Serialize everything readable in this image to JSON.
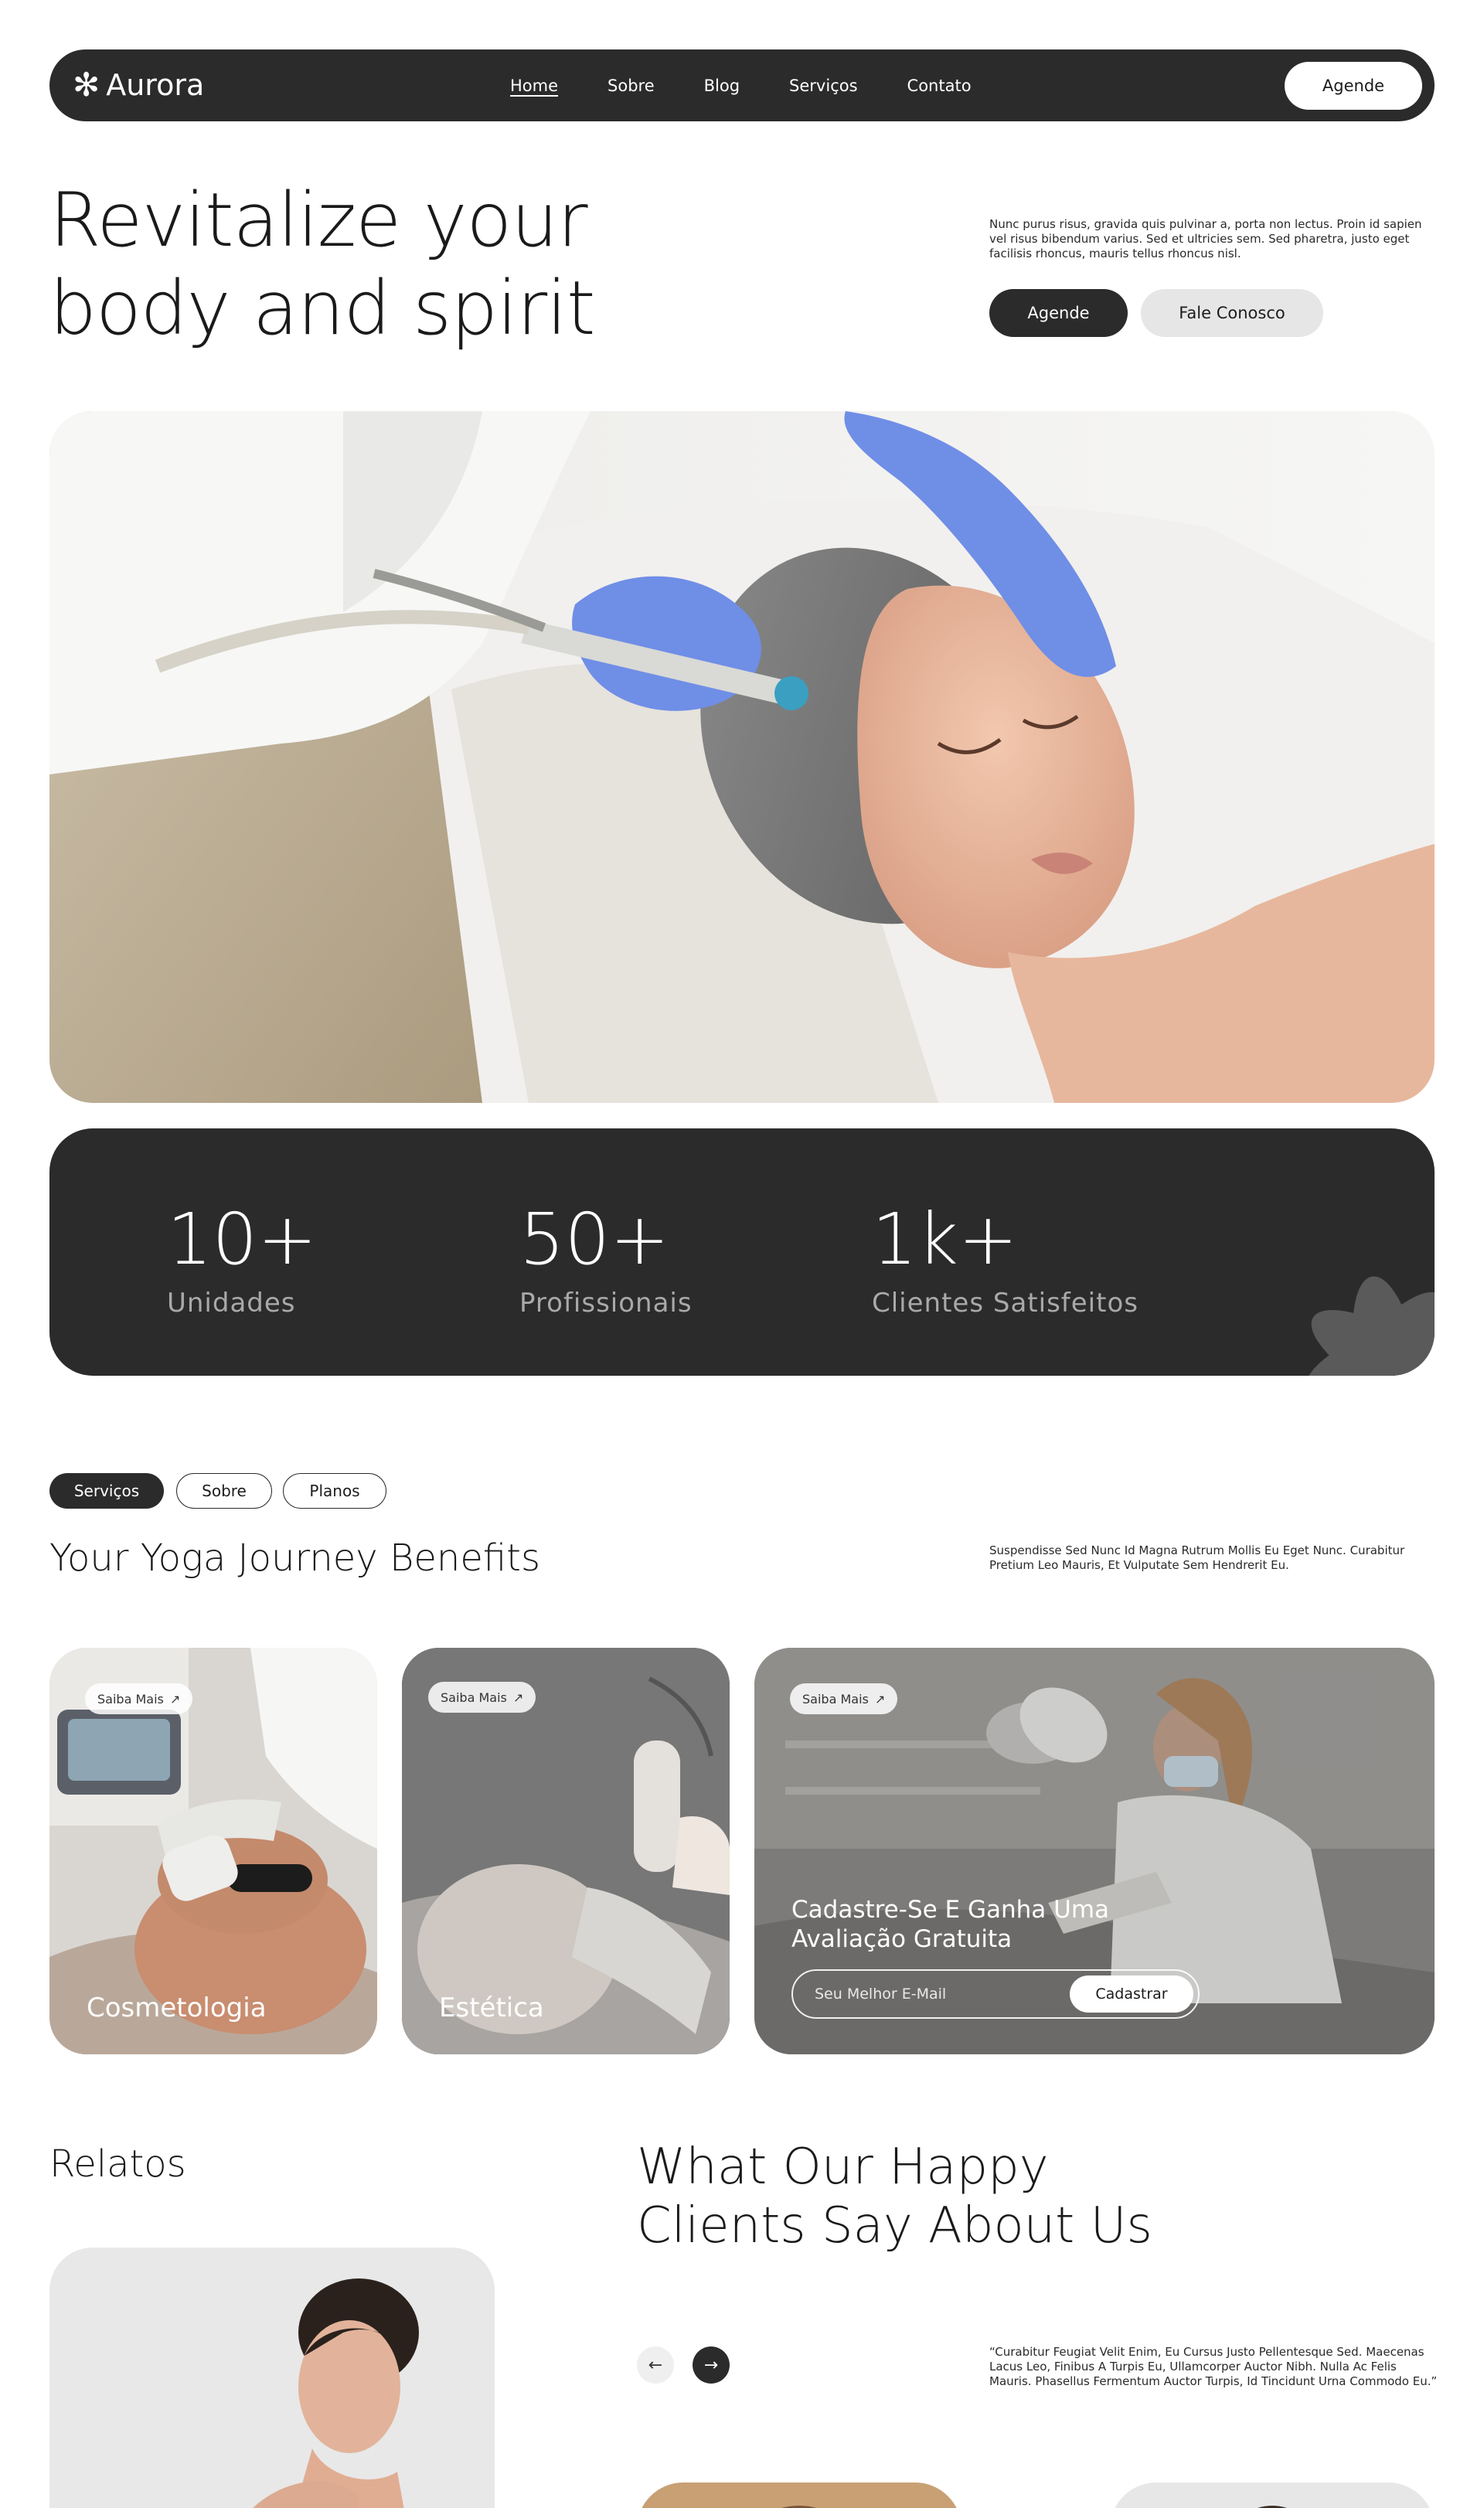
{
  "nav": {
    "logo_text": "Aurora",
    "logo_mark": "✻",
    "links": [
      "Home",
      "Sobre",
      "Blog",
      "Serviços",
      "Contato"
    ],
    "active": "Home",
    "cta_label": "Agende"
  },
  "hero": {
    "title_line1": "Revitalize your",
    "title_line2": "body and spirit",
    "text": "Nunc purus risus, gravida quis pulvinar a, porta non lectus. Proin id sapien vel risus bibendum varius. Sed et ultricies sem. Sed pharetra, justo eget facilisis rhoncus, mauris tellus rhoncus nisl.",
    "primary_label": "Agende",
    "secondary_label": "Fale Conosco"
  },
  "stats": [
    {
      "value": "10+",
      "label": "Unidades"
    },
    {
      "value": "50+",
      "label": "Profissionais"
    },
    {
      "value": "1k+",
      "label": "Clientes Satisfeitos"
    }
  ],
  "services": {
    "tabs": [
      "Serviços",
      "Sobre",
      "Planos"
    ],
    "active_tab": "Serviços",
    "title": "Your Yoga Journey Benefits",
    "text": "Suspendisse Sed Nunc Id Magna Rutrum Mollis Eu Eget Nunc. Curabitur Pretium Leo Mauris, Et Vulputate Sem Hendrerit Eu.",
    "chip_label": "Saiba Mais",
    "cards": [
      {
        "label": "Cosmetologia"
      },
      {
        "label": "Estética"
      }
    ],
    "promo": {
      "title": "Cadastre-Se E Ganha Uma Avaliação Gratuita",
      "input_placeholder": "Seu Melhor E-Mail",
      "button_label": "Cadastrar"
    }
  },
  "testimonials": {
    "section_label": "Relatos",
    "title_line1": "What Our Happy",
    "title_line2": "Clients Say About Us",
    "quote": "“Curabitur Feugiat Velit Enim, Eu Cursus Justo Pellentesque Sed. Maecenas Lacus Leo, Finibus A Turpis Eu, Ullamcorper Auctor Nibh. Nulla Ac Felis Mauris. Phasellus Fermentum Auctor Turpis, Id Tincidunt Urna Commodo Eu.”"
  },
  "icons": {
    "prev": "arrow-left-icon",
    "next": "arrow-right-icon",
    "chip": "arrow-up-right-icon"
  },
  "colors": {
    "dark": "#2b2b2b",
    "light_button": "#e6e6e6",
    "stat_label": "#a9a9a9",
    "glove_blue": "#6f8ee6"
  }
}
